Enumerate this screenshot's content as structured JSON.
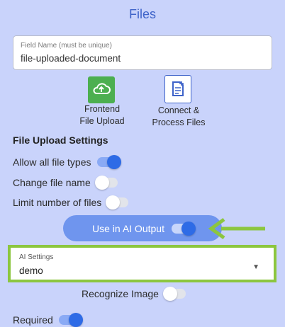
{
  "panel": {
    "title": "Files"
  },
  "field_name": {
    "label": "Field Name (must be unique)",
    "value": "file-uploaded-document"
  },
  "upload_options": [
    {
      "label_line1": "Frontend",
      "label_line2": "File Upload",
      "icon": "cloud-upload-icon",
      "color": "#4caf50"
    },
    {
      "label_line1": "Connect &",
      "label_line2": "Process Files",
      "icon": "document-edit-icon",
      "color": "#3e63c9"
    }
  ],
  "settings": {
    "heading": "File Upload Settings",
    "allow_all_file_types": {
      "label": "Allow all file types",
      "on": true
    },
    "change_file_name": {
      "label": "Change file name",
      "on": false
    },
    "limit_number_of_files": {
      "label": "Limit number of files",
      "on": false
    }
  },
  "ai_output": {
    "label": "Use in AI Output",
    "on": true
  },
  "ai_settings": {
    "label": "AI Settings",
    "value": "demo"
  },
  "recognize_image": {
    "label": "Recognize Image",
    "on": false
  },
  "required": {
    "label": "Required",
    "on": true
  },
  "colors": {
    "background": "#c9d3fb",
    "accent": "#3e63c9",
    "toggle_on": "#2e6be6",
    "highlight": "#8cc63f"
  }
}
